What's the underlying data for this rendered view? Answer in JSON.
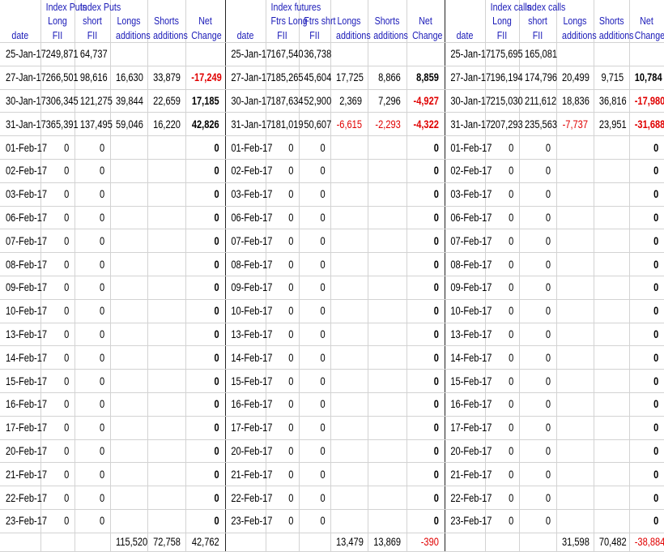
{
  "headers": {
    "row1": [
      "",
      "Index Puts",
      "Index Puts",
      "",
      "",
      "",
      "",
      "Index futures",
      "",
      "",
      "",
      "",
      "",
      "Index calls",
      "Index calls",
      "",
      "",
      ""
    ],
    "row2": [
      "",
      "Long",
      "short",
      "Longs",
      "Shorts",
      "Net",
      "",
      "Ftrs Long",
      "Ftrs shrt",
      "Longs",
      "Shorts",
      "Net",
      "",
      "Long",
      "short",
      "Longs",
      "Shorts",
      "Net"
    ],
    "row3": [
      "date",
      "FII",
      "FII",
      "additions",
      "additions",
      "Change",
      "date",
      "FII",
      "FII",
      "additions",
      "additions",
      "Change",
      "date",
      "FII",
      "FII",
      "additions",
      "additions",
      "Change"
    ]
  },
  "rows": [
    [
      "25-Jan-17",
      "249,871",
      "64,737",
      "",
      "",
      "",
      "25-Jan-17",
      "167,540",
      "36,738",
      "",
      "",
      "",
      "25-Jan-17",
      "175,695",
      "165,081",
      "",
      "",
      ""
    ],
    [
      "27-Jan-17",
      "266,501",
      "98,616",
      "16,630",
      "33,879",
      "-17,249",
      "27-Jan-17",
      "185,265",
      "45,604",
      "17,725",
      "8,866",
      "8,859",
      "27-Jan-17",
      "196,194",
      "174,796",
      "20,499",
      "9,715",
      "10,784"
    ],
    [
      "30-Jan-17",
      "306,345",
      "121,275",
      "39,844",
      "22,659",
      "17,185",
      "30-Jan-17",
      "187,634",
      "52,900",
      "2,369",
      "7,296",
      "-4,927",
      "30-Jan-17",
      "215,030",
      "211,612",
      "18,836",
      "36,816",
      "-17,980"
    ],
    [
      "31-Jan-17",
      "365,391",
      "137,495",
      "59,046",
      "16,220",
      "42,826",
      "31-Jan-17",
      "181,019",
      "50,607",
      "-6,615",
      "-2,293",
      "-4,322",
      "31-Jan-17",
      "207,293",
      "235,563",
      "-7,737",
      "23,951",
      "-31,688"
    ],
    [
      "01-Feb-17",
      "0",
      "0",
      "",
      "",
      "0",
      "01-Feb-17",
      "0",
      "0",
      "",
      "",
      "0",
      "01-Feb-17",
      "0",
      "0",
      "",
      "",
      "0"
    ],
    [
      "02-Feb-17",
      "0",
      "0",
      "",
      "",
      "0",
      "02-Feb-17",
      "0",
      "0",
      "",
      "",
      "0",
      "02-Feb-17",
      "0",
      "0",
      "",
      "",
      "0"
    ],
    [
      "03-Feb-17",
      "0",
      "0",
      "",
      "",
      "0",
      "03-Feb-17",
      "0",
      "0",
      "",
      "",
      "0",
      "03-Feb-17",
      "0",
      "0",
      "",
      "",
      "0"
    ],
    [
      "06-Feb-17",
      "0",
      "0",
      "",
      "",
      "0",
      "06-Feb-17",
      "0",
      "0",
      "",
      "",
      "0",
      "06-Feb-17",
      "0",
      "0",
      "",
      "",
      "0"
    ],
    [
      "07-Feb-17",
      "0",
      "0",
      "",
      "",
      "0",
      "07-Feb-17",
      "0",
      "0",
      "",
      "",
      "0",
      "07-Feb-17",
      "0",
      "0",
      "",
      "",
      "0"
    ],
    [
      "08-Feb-17",
      "0",
      "0",
      "",
      "",
      "0",
      "08-Feb-17",
      "0",
      "0",
      "",
      "",
      "0",
      "08-Feb-17",
      "0",
      "0",
      "",
      "",
      "0"
    ],
    [
      "09-Feb-17",
      "0",
      "0",
      "",
      "",
      "0",
      "09-Feb-17",
      "0",
      "0",
      "",
      "",
      "0",
      "09-Feb-17",
      "0",
      "0",
      "",
      "",
      "0"
    ],
    [
      "10-Feb-17",
      "0",
      "0",
      "",
      "",
      "0",
      "10-Feb-17",
      "0",
      "0",
      "",
      "",
      "0",
      "10-Feb-17",
      "0",
      "0",
      "",
      "",
      "0"
    ],
    [
      "13-Feb-17",
      "0",
      "0",
      "",
      "",
      "0",
      "13-Feb-17",
      "0",
      "0",
      "",
      "",
      "0",
      "13-Feb-17",
      "0",
      "0",
      "",
      "",
      "0"
    ],
    [
      "14-Feb-17",
      "0",
      "0",
      "",
      "",
      "0",
      "14-Feb-17",
      "0",
      "0",
      "",
      "",
      "0",
      "14-Feb-17",
      "0",
      "0",
      "",
      "",
      "0"
    ],
    [
      "15-Feb-17",
      "0",
      "0",
      "",
      "",
      "0",
      "15-Feb-17",
      "0",
      "0",
      "",
      "",
      "0",
      "15-Feb-17",
      "0",
      "0",
      "",
      "",
      "0"
    ],
    [
      "16-Feb-17",
      "0",
      "0",
      "",
      "",
      "0",
      "16-Feb-17",
      "0",
      "0",
      "",
      "",
      "0",
      "16-Feb-17",
      "0",
      "0",
      "",
      "",
      "0"
    ],
    [
      "17-Feb-17",
      "0",
      "0",
      "",
      "",
      "0",
      "17-Feb-17",
      "0",
      "0",
      "",
      "",
      "0",
      "17-Feb-17",
      "0",
      "0",
      "",
      "",
      "0"
    ],
    [
      "20-Feb-17",
      "0",
      "0",
      "",
      "",
      "0",
      "20-Feb-17",
      "0",
      "0",
      "",
      "",
      "0",
      "20-Feb-17",
      "0",
      "0",
      "",
      "",
      "0"
    ],
    [
      "21-Feb-17",
      "0",
      "0",
      "",
      "",
      "0",
      "21-Feb-17",
      "0",
      "0",
      "",
      "",
      "0",
      "21-Feb-17",
      "0",
      "0",
      "",
      "",
      "0"
    ],
    [
      "22-Feb-17",
      "0",
      "0",
      "",
      "",
      "0",
      "22-Feb-17",
      "0",
      "0",
      "",
      "",
      "0",
      "22-Feb-17",
      "0",
      "0",
      "",
      "",
      "0"
    ],
    [
      "23-Feb-17",
      "0",
      "0",
      "",
      "",
      "0",
      "23-Feb-17",
      "0",
      "0",
      "",
      "",
      "0",
      "23-Feb-17",
      "0",
      "0",
      "",
      "",
      "0"
    ]
  ],
  "totals": [
    "",
    "",
    "",
    "115,520",
    "72,758",
    "42,762",
    "",
    "",
    "",
    "13,479",
    "13,869",
    "-390",
    "",
    "",
    "",
    "31,598",
    "70,482",
    "-38,884"
  ],
  "colors": {
    "header_text": "#1a1ab8",
    "negative_text": "#e00000",
    "gridline": "#d3d3d3"
  }
}
